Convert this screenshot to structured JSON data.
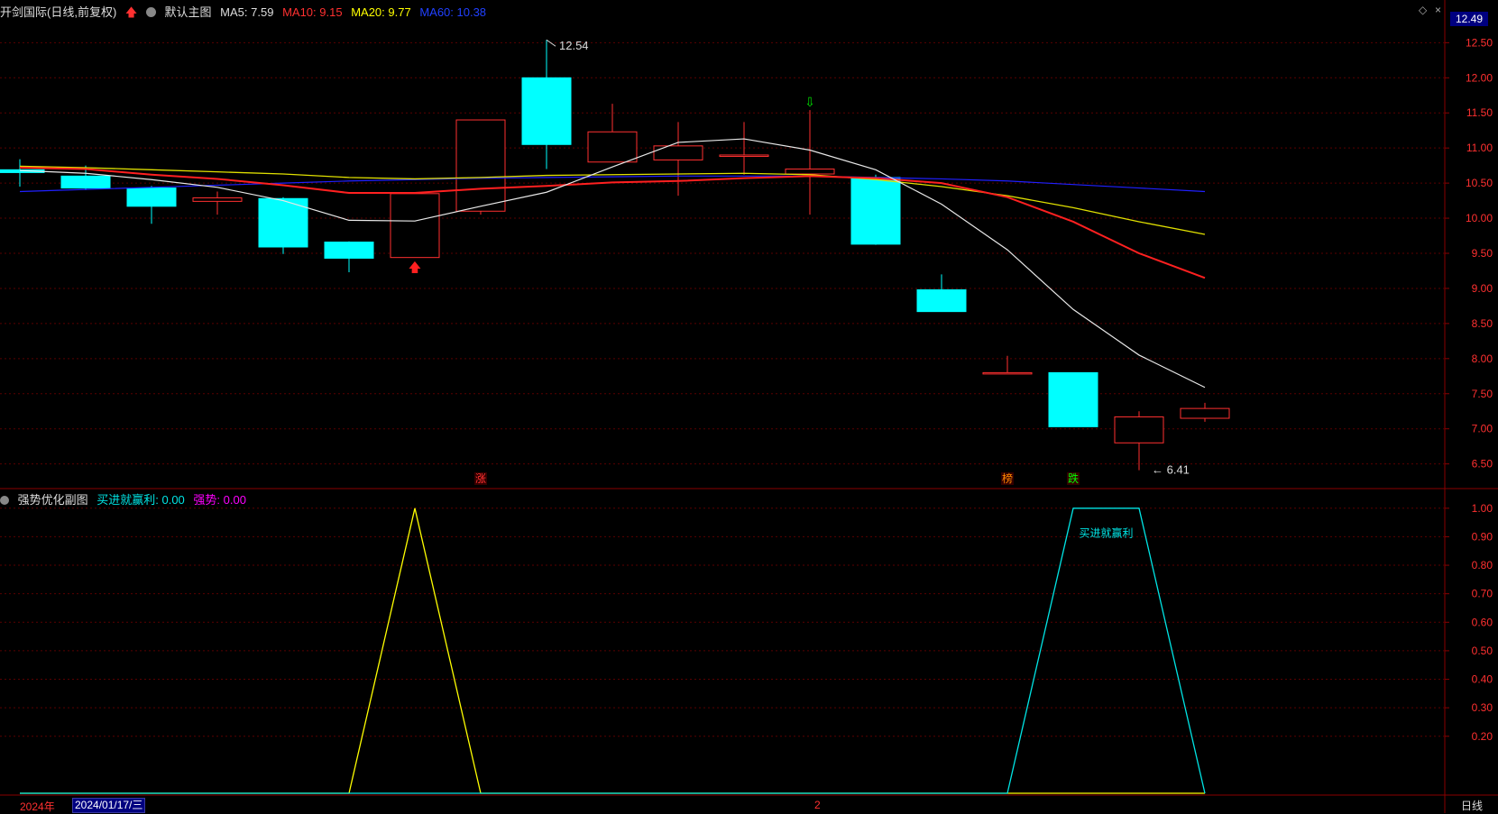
{
  "header": {
    "stock_title": "开剑国际(日线,前复权)",
    "theme": "默认主图",
    "ma5_label": "MA5: 7.59",
    "ma10_label": "MA10: 9.15",
    "ma20_label": "MA20: 9.77",
    "ma60_label": "MA60: 10.38"
  },
  "sub_header": {
    "title": "强势优化副图",
    "buy_label": "买进就赢利: 0.00",
    "strong_label": "强势: 0.00"
  },
  "current_price": "12.49",
  "footer": {
    "year": "2024年",
    "date": "2024/01/17/三",
    "tick": "2",
    "period": "日线"
  },
  "colors": {
    "up": "#ff3030",
    "down": "#00ffff",
    "ma5": "#e8e8e8",
    "ma10": "#ff2020",
    "ma20": "#e0e000",
    "ma60": "#2020ff",
    "grid": "#5a0000",
    "sub_yellow": "#ffff00",
    "sub_cyan": "#00e5e5"
  },
  "chart_data": [
    {
      "type": "candlestick",
      "ylim": [
        6.2,
        12.8
      ],
      "yticks": [
        "12.50",
        "12.00",
        "11.50",
        "11.00",
        "10.50",
        "10.00",
        "9.50",
        "9.00",
        "8.50",
        "8.00",
        "7.50",
        "7.00",
        "6.50"
      ],
      "candles": [
        {
          "o": 10.69,
          "h": 10.84,
          "l": 10.45,
          "c": 10.65
        },
        {
          "o": 10.6,
          "h": 10.75,
          "l": 10.4,
          "c": 10.43
        },
        {
          "o": 10.43,
          "h": 10.46,
          "l": 9.92,
          "c": 10.17
        },
        {
          "o": 10.24,
          "h": 10.38,
          "l": 10.05,
          "c": 10.29
        },
        {
          "o": 10.28,
          "h": 10.3,
          "l": 9.49,
          "c": 9.59
        },
        {
          "o": 9.66,
          "h": 9.67,
          "l": 9.23,
          "c": 9.43
        },
        {
          "o": 9.44,
          "h": 10.35,
          "l": 9.44,
          "c": 10.35
        },
        {
          "o": 10.1,
          "h": 11.4,
          "l": 10.05,
          "c": 11.4
        },
        {
          "o": 12.0,
          "h": 12.54,
          "l": 10.7,
          "c": 11.05
        },
        {
          "o": 10.8,
          "h": 11.63,
          "l": 10.8,
          "c": 11.23
        },
        {
          "o": 10.83,
          "h": 11.37,
          "l": 10.32,
          "c": 11.03
        },
        {
          "o": 10.88,
          "h": 11.37,
          "l": 10.62,
          "c": 10.9
        },
        {
          "o": 10.63,
          "h": 11.54,
          "l": 10.05,
          "c": 10.7
        },
        {
          "o": 10.58,
          "h": 10.62,
          "l": 9.62,
          "c": 9.63
        },
        {
          "o": 8.98,
          "h": 9.2,
          "l": 8.67,
          "c": 8.67
        },
        {
          "o": 7.8,
          "h": 8.04,
          "l": 7.8,
          "c": 7.8
        },
        {
          "o": 7.8,
          "h": 7.8,
          "l": 7.03,
          "c": 7.03
        },
        {
          "o": 6.8,
          "h": 7.25,
          "l": 6.41,
          "c": 7.17
        },
        {
          "o": 7.15,
          "h": 7.37,
          "l": 7.1,
          "c": 7.29
        }
      ],
      "ma5": [
        10.68,
        10.64,
        10.55,
        10.44,
        10.25,
        9.97,
        9.96,
        10.17,
        10.37,
        10.73,
        11.08,
        11.13,
        10.97,
        10.69,
        10.2,
        9.55,
        8.7,
        8.05,
        7.59
      ],
      "ma10": [
        10.72,
        10.7,
        10.62,
        10.56,
        10.47,
        10.36,
        10.36,
        10.42,
        10.46,
        10.51,
        10.53,
        10.57,
        10.6,
        10.57,
        10.5,
        10.3,
        9.95,
        9.5,
        9.15
      ],
      "ma20": [
        10.74,
        10.72,
        10.69,
        10.66,
        10.63,
        10.58,
        10.56,
        10.58,
        10.61,
        10.62,
        10.63,
        10.64,
        10.62,
        10.55,
        10.45,
        10.32,
        10.15,
        9.95,
        9.77
      ],
      "ma60": [
        10.38,
        10.41,
        10.44,
        10.47,
        10.5,
        10.53,
        10.55,
        10.57,
        10.58,
        10.59,
        10.6,
        10.6,
        10.6,
        10.58,
        10.56,
        10.53,
        10.48,
        10.43,
        10.38
      ],
      "high_annotation": "12.54",
      "low_annotation": "6.41",
      "signals": [
        {
          "index": 6,
          "type": "buy-arrow"
        },
        {
          "index": 12,
          "type": "sell-arrow"
        }
      ],
      "markers": [
        {
          "index": 7,
          "text": "涨",
          "color": "#ff3030"
        },
        {
          "index": 15,
          "text": "榜",
          "color": "#ff8800"
        },
        {
          "index": 16,
          "text": "跌",
          "color": "#00ff00"
        }
      ]
    },
    {
      "type": "line",
      "ylim": [
        0,
        1.05
      ],
      "yticks": [
        "1.00",
        "0.90",
        "0.80",
        "0.70",
        "0.60",
        "0.50",
        "0.40",
        "0.30",
        "0.20"
      ],
      "series": [
        {
          "name": "强势",
          "values": [
            0,
            0,
            0,
            0,
            0,
            0,
            1,
            0,
            0,
            0,
            0,
            0,
            0,
            0,
            0,
            0,
            0,
            0,
            0
          ]
        },
        {
          "name": "买进就赢利",
          "values": [
            0,
            0,
            0,
            0,
            0,
            0,
            0,
            0,
            0,
            0,
            0,
            0,
            0,
            0,
            0,
            0,
            1,
            1,
            0
          ]
        }
      ],
      "annotation": "买进就赢利"
    }
  ]
}
